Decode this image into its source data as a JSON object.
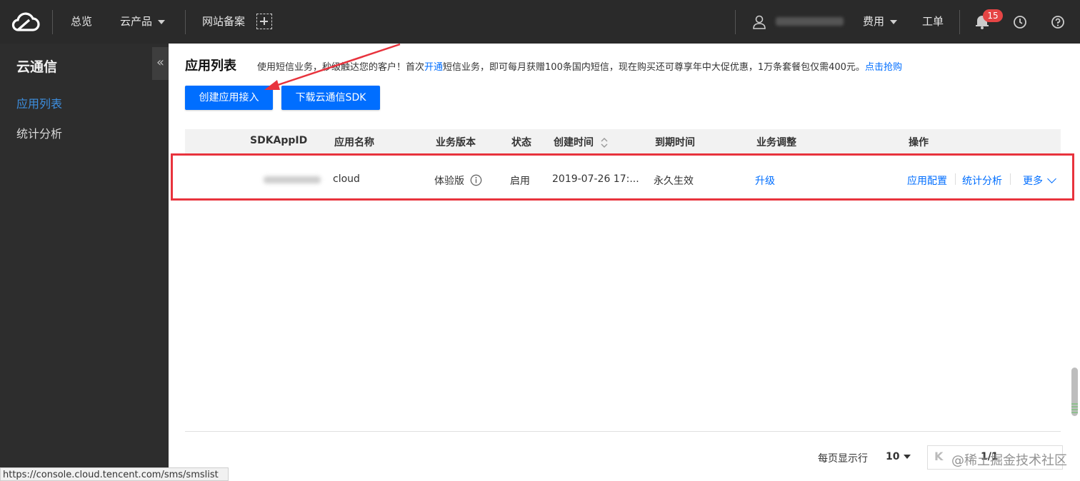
{
  "topnav": {
    "overview": "总览",
    "products": "云产品",
    "icp": "网站备案",
    "billing": "费用",
    "tickets": "工单",
    "notifications_count": "15"
  },
  "sidebar": {
    "title": "云通信",
    "items": [
      {
        "label": "应用列表",
        "active": true
      },
      {
        "label": "统计分析",
        "active": false
      }
    ],
    "collapse_label": "«"
  },
  "main": {
    "title": "应用列表",
    "notice": {
      "part1": "使用短信业务，秒级触达您的客户！首次",
      "link1": "开通",
      "part2": "短信业务，即可每月获赠100条国内短信，现在购买还可尊享年中大促优惠，1万条套餐包仅需400元。",
      "link2": "点击抢购"
    },
    "buttons": {
      "create": "创建应用接入",
      "download": "下载云通信SDK"
    },
    "table": {
      "headers": [
        "SDKAppID",
        "应用名称",
        "业务版本",
        "状态",
        "创建时间",
        "到期时间",
        "业务调整",
        "操作"
      ],
      "rows": [
        {
          "name": "cloud",
          "version": "体验版",
          "status": "启用",
          "created": "2019-07-26 17:...",
          "expires": "永久生效",
          "adjust": "升级",
          "ops": [
            "应用配置",
            "统计分析",
            "更多"
          ]
        }
      ]
    },
    "pager": {
      "per_page_label": "每页显示行",
      "per_page_value": "10",
      "page": "1/1"
    },
    "watermark": "@稀土掘金技术社区"
  },
  "statusbar": "https://console.cloud.tencent.com/sms/smslist",
  "colors": {
    "accent": "#006eff",
    "nav_bg": "#2a2a2a",
    "sidebar_bg": "#2d2d2d",
    "highlight": "#e8333d",
    "badge": "#e54545"
  }
}
